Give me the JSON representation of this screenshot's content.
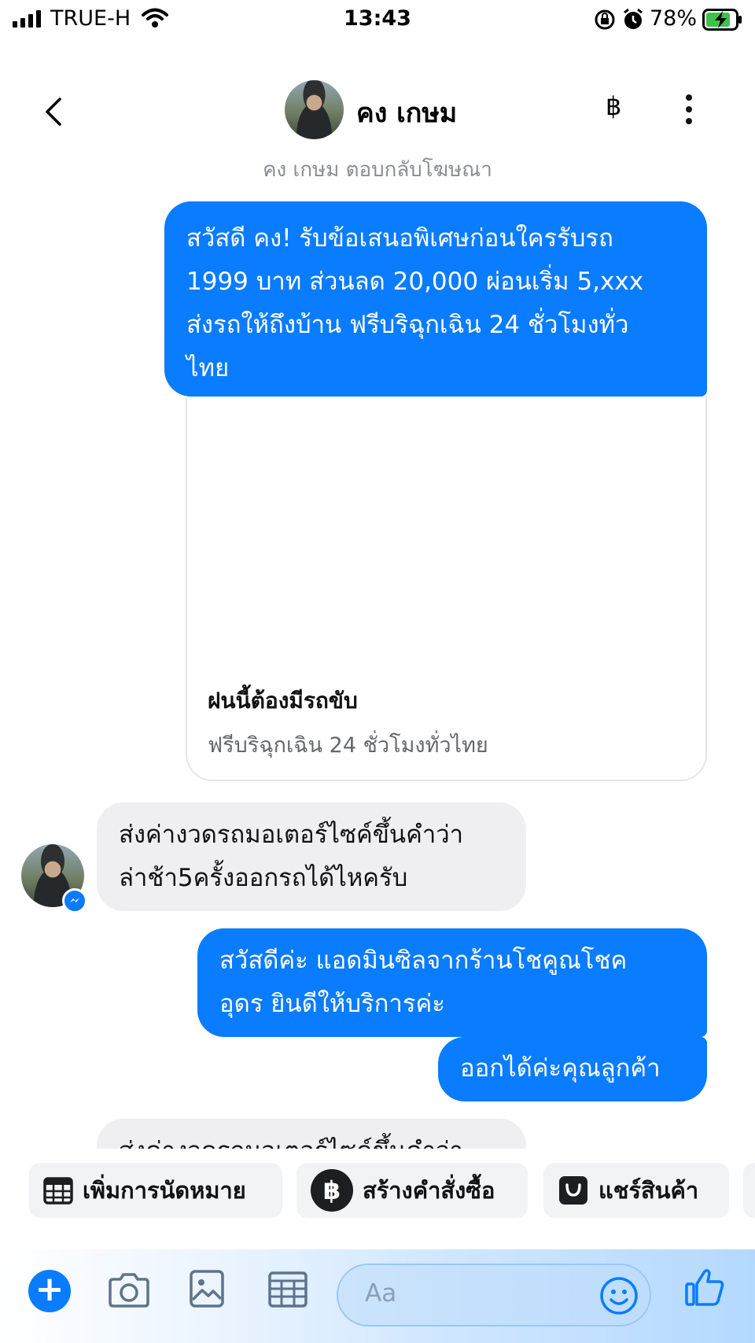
{
  "status_bar": {
    "carrier": "TRUE-H",
    "time": "13:43",
    "battery_percent": "78%"
  },
  "header": {
    "contact_name": "คง เกษม",
    "subtitle": "คง เกษม ตอบกลับโฆษณา",
    "baht_symbol": "฿"
  },
  "messages": [
    {
      "direction": "outgoing",
      "lines": [
        "สวัสดี คง! รับข้อเสนอพิเศษก่อนใครรับรถ",
        "1999 บาท ส่วนลด 20,000 ผ่อนเริ่ม 5,xxx",
        "ส่งรถให้ถึงบ้าน ฟรีบริฉุกเฉิน 24 ชั่วโมงทั่ว",
        "ไทย"
      ]
    },
    {
      "direction": "incoming",
      "lines": [
        "ส่งค่างวดรถมอเตอร์ไซค์ขึ้นคำว่า",
        "ล่าช้า5ครั้งออกรถได้ไหครับ"
      ]
    },
    {
      "direction": "outgoing",
      "lines": [
        "สวัสดีค่ะ แอดมินซิลจากร้านโชคูณโชค",
        "อุดร ยินดีให้บริการค่ะ"
      ]
    },
    {
      "direction": "outgoing",
      "lines": [
        "ออกได้ค่ะคุณลูกค้า"
      ]
    },
    {
      "direction": "incoming",
      "lines": [
        "ส่งค่างวดรถมอเตอร์ไซค์ขึ้นคำว่า",
        ""
      ]
    }
  ],
  "ad_card": {
    "title": "ฝนนี้ต้องมีรถขับ",
    "subtitle": "ฟรีบริฉุกเฉิน 24 ชั่วโมงทั่วไทย"
  },
  "quick_actions": {
    "appointment": "เพิ่มการนัดหมาย",
    "create_order": "สร้างคำสั่งซื้อ",
    "share_product": "แชร์สินค้า",
    "baht_symbol": "฿"
  },
  "composer": {
    "placeholder": "Aa",
    "plus": "+"
  },
  "colors": {
    "accent": "#0a7cff",
    "incoming_bubble": "#efeff2",
    "subtle_text": "#8a8d91"
  }
}
